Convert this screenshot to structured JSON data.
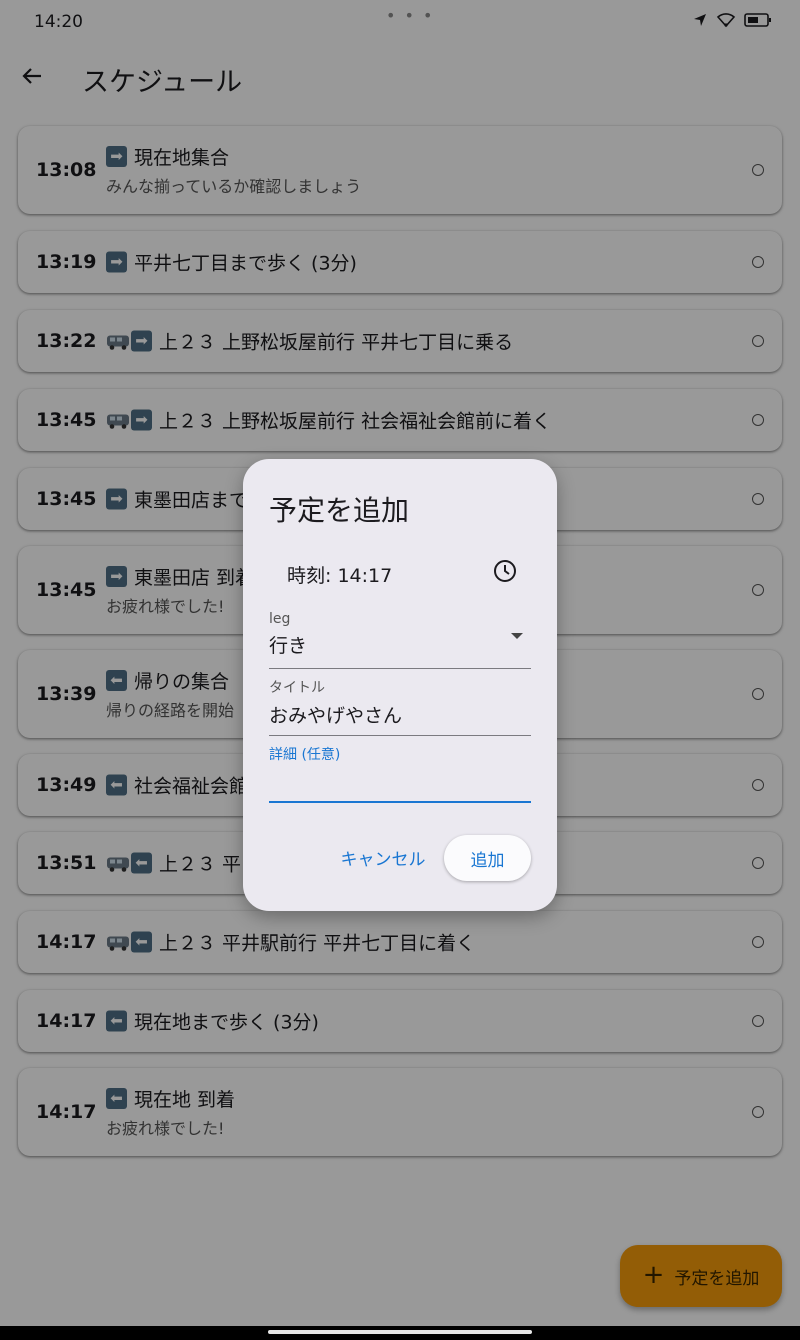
{
  "status_bar": {
    "time": "14:20",
    "dots": "• • •"
  },
  "app_bar": {
    "title": "スケジュール"
  },
  "schedule": [
    {
      "time": "13:08",
      "icon": "arrow-right",
      "title": "現在地集合",
      "subtitle": "みんな揃っているか確認しましょう"
    },
    {
      "time": "13:19",
      "icon": "arrow-right",
      "title": "平井七丁目まで歩く (3分)",
      "subtitle": ""
    },
    {
      "time": "13:22",
      "icon": "bus-arrow-right",
      "title": "上２３ 上野松坂屋前行 平井七丁目に乗る",
      "subtitle": ""
    },
    {
      "time": "13:45",
      "icon": "bus-arrow-right",
      "title": "上２３ 上野松坂屋前行 社会福祉会館前に着く",
      "subtitle": ""
    },
    {
      "time": "13:45",
      "icon": "arrow-right",
      "title": "東墨田店まで",
      "subtitle": ""
    },
    {
      "time": "13:45",
      "icon": "arrow-right",
      "title": "東墨田店 到着",
      "subtitle": "お疲れ様でした!"
    },
    {
      "time": "13:39",
      "icon": "arrow-left",
      "title": "帰りの集合",
      "subtitle": "帰りの経路を開始"
    },
    {
      "time": "13:49",
      "icon": "arrow-left",
      "title": "社会福祉会館",
      "subtitle": ""
    },
    {
      "time": "13:51",
      "icon": "bus-arrow-left",
      "title": "上２３ 平",
      "subtitle": ""
    },
    {
      "time": "14:17",
      "icon": "bus-arrow-left",
      "title": "上２３ 平井駅前行 平井七丁目に着く",
      "subtitle": ""
    },
    {
      "time": "14:17",
      "icon": "arrow-left",
      "title": "現在地まで歩く (3分)",
      "subtitle": ""
    },
    {
      "time": "14:17",
      "icon": "arrow-left",
      "title": "現在地 到着",
      "subtitle": "お疲れ様でした!"
    }
  ],
  "fab": {
    "label": "予定を追加"
  },
  "dialog": {
    "title": "予定を追加",
    "time_label": "時刻: 14:17",
    "leg": {
      "label": "leg",
      "value": "行き"
    },
    "title_field": {
      "label": "タイトル",
      "value": "おみやげやさん"
    },
    "detail_field": {
      "label": "詳細 (任意)",
      "value": ""
    },
    "cancel_label": "キャンセル",
    "add_label": "追加"
  },
  "colors": {
    "accent": "#1976d2",
    "fab": "#f59c0a",
    "dialog_bg": "#ebe9f0"
  }
}
